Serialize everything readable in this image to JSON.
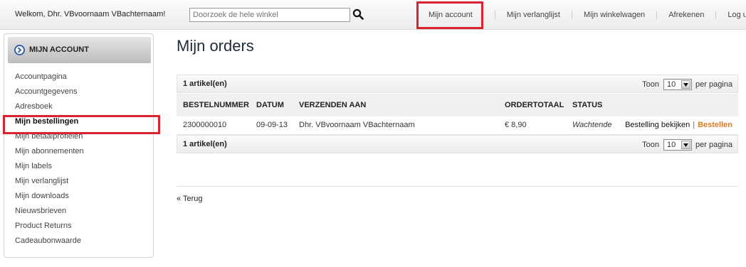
{
  "header": {
    "welcome": "Welkom, Dhr. VBvoornaam VBachternaam!",
    "search_placeholder": "Doorzoek de hele winkel",
    "nav": {
      "account": "Mijn account",
      "wishlist": "Mijn verlanglijst",
      "cart": "Mijn winkelwagen",
      "checkout": "Afrekenen",
      "logout": "Log uit"
    }
  },
  "sidebar": {
    "title": "MIJN ACCOUNT",
    "items": [
      {
        "label": "Accountpagina"
      },
      {
        "label": "Accountgegevens"
      },
      {
        "label": "Adresboek"
      },
      {
        "label": "Mijn bestellingen"
      },
      {
        "label": "Mijn betaalprofielen"
      },
      {
        "label": "Mijn abonnementen"
      },
      {
        "label": "Mijn labels"
      },
      {
        "label": "Mijn verlanglijst"
      },
      {
        "label": "Mijn downloads"
      },
      {
        "label": "Nieuwsbrieven"
      },
      {
        "label": "Product Returns"
      },
      {
        "label": "Cadeaubonwaarde"
      }
    ],
    "active_index": 3
  },
  "main": {
    "title": "Mijn orders",
    "pager": {
      "count": "1 artikel(en)",
      "show_label": "Toon",
      "per_page_value": "10",
      "per_page_suffix": "per pagina"
    },
    "table": {
      "headers": {
        "number": "BESTELNUMMER",
        "date": "DATUM",
        "ship_to": "VERZENDEN AAN",
        "total": "ORDERTOTAAL",
        "status": "STATUS"
      },
      "rows": [
        {
          "number": "2300000010",
          "date": "09-09-13",
          "ship_to": "Dhr. VBvoornaam VBachternaam",
          "total": "€ 8,90",
          "status": "Wachtende",
          "view": "Bestelling bekijken",
          "sep": "|",
          "reorder": "Bestellen"
        }
      ]
    },
    "back": "« Terug"
  },
  "colors": {
    "highlight_red": "#d9232e",
    "reorder_orange": "#e07b18",
    "title_navy": "#1f2b3a"
  }
}
